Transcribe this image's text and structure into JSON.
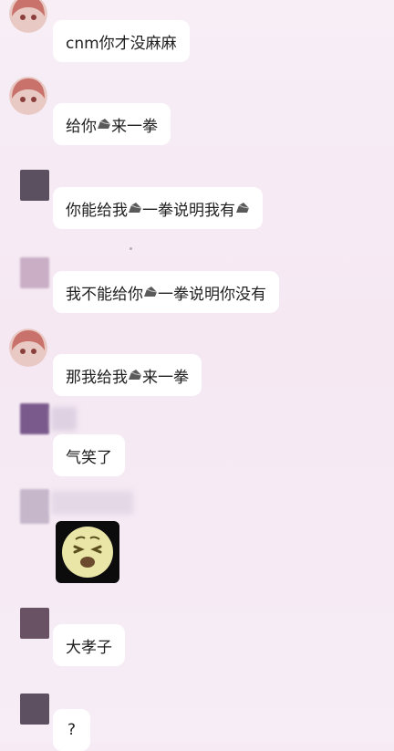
{
  "messages": [
    {
      "text": "cnm你才没麻麻"
    },
    {
      "before": "给你",
      "after": "来一拳",
      "icon": "rock-icon"
    },
    {
      "before": "你能给我",
      "middle": "一拳说明我有",
      "icon": "rock-icon"
    },
    {
      "before": "我不能给你",
      "after": "一拳说明你没有",
      "icon": "rock-icon"
    },
    {
      "before": "那我给我",
      "after": "来一拳",
      "icon": "rock-icon"
    },
    {
      "text": "气笑了"
    },
    {
      "sticker": "laughing-face-sticker"
    },
    {
      "text": "大孝子"
    },
    {
      "text": "?"
    }
  ],
  "colors": {
    "background": "#f6ebf5",
    "bubble": "#ffffff",
    "text": "#1f1f1f",
    "avatar_hair": "#c9726b"
  }
}
